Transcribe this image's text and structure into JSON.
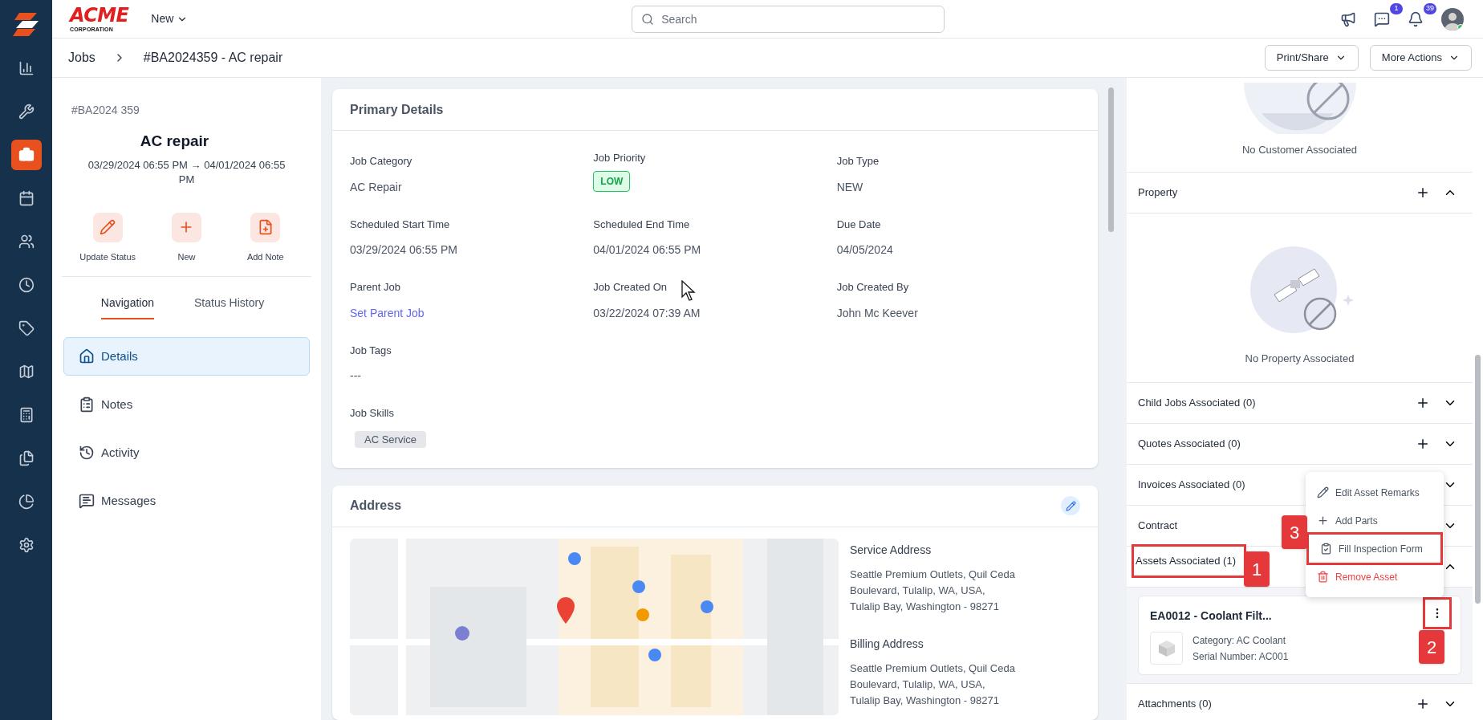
{
  "topbar": {
    "brand": "ACME",
    "brand_sub": "CORPORATION",
    "new_menu": "New",
    "search": {
      "placeholder": "Search"
    },
    "icons": [
      {
        "kind": "announce"
      },
      {
        "kind": "chat",
        "count": "1"
      },
      {
        "kind": "bell",
        "count": "39"
      },
      {
        "kind": "avatar",
        "online": true
      }
    ]
  },
  "rail": [
    {
      "kind": "reports",
      "selected": false
    },
    {
      "kind": "tools",
      "selected": false
    },
    {
      "kind": "jobs",
      "selected": true
    },
    {
      "kind": "calendar",
      "selected": false
    },
    {
      "kind": "users",
      "selected": false
    },
    {
      "kind": "time",
      "selected": false
    },
    {
      "kind": "tags",
      "selected": false
    },
    {
      "kind": "map",
      "selected": false
    },
    {
      "kind": "calculator",
      "selected": false
    },
    {
      "kind": "files",
      "selected": false
    },
    {
      "kind": "pie",
      "selected": false
    },
    {
      "kind": "settings",
      "selected": false
    }
  ],
  "breadcrumb": {
    "items": [
      "Jobs",
      "#BA2024359 - AC repair"
    ],
    "buttons": [
      "Print/Share",
      "More Actions"
    ]
  },
  "job": {
    "number": "#BA2024 359",
    "title": "AC repair",
    "schedule": "03/29/2024 06:55 PM → 04/01/2024 06:55 PM",
    "actions": [
      {
        "kind": "edit",
        "label": "Update Status"
      },
      {
        "kind": "add",
        "label": "New"
      },
      {
        "kind": "note",
        "label": "Add Note"
      }
    ],
    "tabs": [
      {
        "label": "Navigation",
        "selected": true
      },
      {
        "label": "Status History",
        "selected": false
      }
    ],
    "nav": [
      {
        "kind": "home",
        "label": "Details",
        "selected": true
      },
      {
        "kind": "notes",
        "label": "Notes",
        "selected": false
      },
      {
        "kind": "activity",
        "label": "Activity",
        "selected": false
      },
      {
        "kind": "messages",
        "label": "Messages",
        "selected": false
      }
    ]
  },
  "primary_details": {
    "title": "Primary Details",
    "rows": [
      [
        {
          "label": "Job Category",
          "kind": "text",
          "value": "AC Repair"
        },
        {
          "label": "Job Priority",
          "kind": "badge",
          "value": "LOW"
        },
        {
          "label": "Job Type",
          "kind": "text",
          "value": "NEW"
        }
      ],
      [
        {
          "label": "Scheduled Start Time",
          "kind": "text",
          "value": "03/29/2024 06:55 PM"
        },
        {
          "label": "Scheduled End Time",
          "kind": "text",
          "value": "04/01/2024 06:55 PM"
        },
        {
          "label": "Due Date",
          "kind": "text",
          "value": "04/05/2024"
        }
      ],
      [
        {
          "label": "Parent Job",
          "kind": "link",
          "value": "Set Parent Job"
        },
        {
          "label": "Job Created On",
          "kind": "text",
          "value": "03/22/2024 07:39 AM"
        },
        {
          "label": "Job Created By",
          "kind": "text",
          "value": "John Mc Keever"
        }
      ],
      [
        {
          "label": "Job Tags",
          "kind": "text",
          "value": "---"
        }
      ],
      [
        {
          "label": "Job Skills",
          "kind": "tag",
          "value": "AC Service"
        }
      ]
    ]
  },
  "address": {
    "title": "Address",
    "entries": [
      {
        "label": "Service Address",
        "lines": [
          "Seattle Premium Outlets, Quil Ceda",
          "Boulevard, Tulalip, WA, USA,",
          "Tulalip Bay, Washington - 98271"
        ]
      },
      {
        "label": "Billing Address",
        "lines": [
          "Seattle Premium Outlets, Quil Ceda",
          "Boulevard, Tulalip, WA, USA,",
          "Tulalip Bay, Washington - 98271"
        ]
      }
    ]
  },
  "right_panel": {
    "customer_empty": "No Customer Associated",
    "sections": [
      {
        "title": "Property",
        "add": true,
        "expanded": true,
        "empty_text": "No Property Associated"
      },
      {
        "title": "Child Jobs Associated (0)",
        "add": true,
        "expanded": false
      },
      {
        "title": "Quotes Associated (0)",
        "add": true,
        "expanded": false
      },
      {
        "title": "Invoices Associated (0)",
        "add": false,
        "expanded": false
      },
      {
        "title": "Contract",
        "add": false,
        "expanded": false
      },
      {
        "title": "Assets Associated (1)",
        "add": false,
        "expanded": true,
        "callout": "1",
        "asset": {
          "title": "EA0012 - Coolant Filt...",
          "details": [
            "Category: AC Coolant",
            "Serial Number: AC001"
          ],
          "menu_callout": "2"
        }
      },
      {
        "title": "Attachments (0)",
        "add": true,
        "expanded": false
      }
    ]
  },
  "asset_menu": {
    "items": [
      {
        "kind": "edit",
        "label": "Edit Asset Remarks"
      },
      {
        "kind": "add",
        "label": "Add Parts"
      },
      {
        "kind": "inspection",
        "label": "Fill Inspection Form",
        "callout": "3"
      },
      {
        "kind": "remove",
        "label": "Remove Asset"
      }
    ]
  }
}
